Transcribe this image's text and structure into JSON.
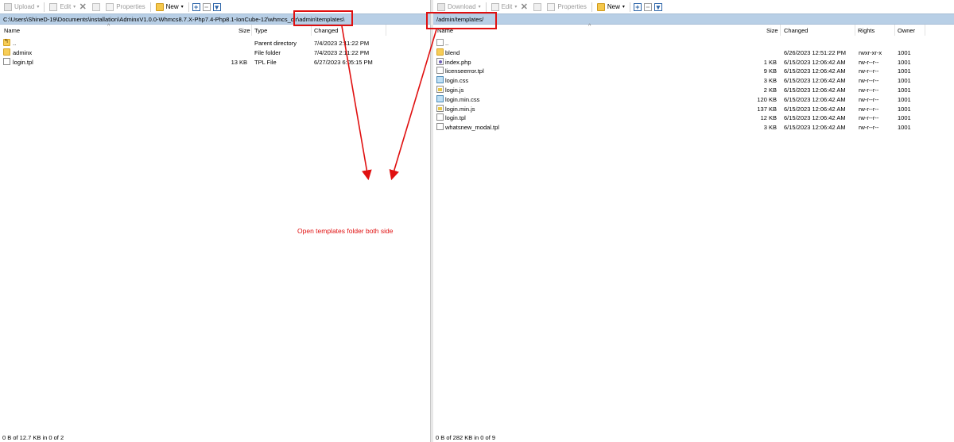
{
  "toolbar_left": {
    "upload_label": "Upload",
    "edit_label": "Edit",
    "properties_label": "Properties",
    "new_label": "New"
  },
  "toolbar_right": {
    "download_label": "Download",
    "edit_label": "Edit",
    "properties_label": "Properties",
    "new_label": "New"
  },
  "left": {
    "path": "C:\\Users\\ShineD-19\\Documents\\installation\\AdminxV1.0.0-Whmcs8.7.X-Php7.4-Php8.1-IonCube-12\\whmcs_dir\\admin\\templates\\",
    "columns": {
      "name": "Name",
      "size": "Size",
      "type": "Type",
      "changed": "Changed"
    },
    "files": [
      {
        "name": "..",
        "size": "",
        "type": "Parent directory",
        "changed": "7/4/2023  2:11:22 PM",
        "icon": "parent-folder-icon"
      },
      {
        "name": "adminx",
        "size": "",
        "type": "File folder",
        "changed": "7/4/2023  2:11:22 PM",
        "icon": "folder-icon"
      },
      {
        "name": "login.tpl",
        "size": "13 KB",
        "type": "TPL File",
        "changed": "6/27/2023  6:05:15 PM",
        "icon": "file-icon"
      }
    ],
    "status": "0 B of 12.7 KB in 0 of 2"
  },
  "right": {
    "path": "/admin/templates/",
    "columns": {
      "name": "Name",
      "size": "Size",
      "changed": "Changed",
      "rights": "Rights",
      "owner": "Owner"
    },
    "files": [
      {
        "name": "..",
        "size": "",
        "changed": "",
        "rights": "",
        "owner": "",
        "icon": "parent-folder-icon"
      },
      {
        "name": "blend",
        "size": "",
        "changed": "6/26/2023 12:51:22 PM",
        "rights": "rwxr-xr-x",
        "owner": "1001",
        "icon": "folder-icon"
      },
      {
        "name": "index.php",
        "size": "1 KB",
        "changed": "6/15/2023 12:06:42 AM",
        "rights": "rw-r--r--",
        "owner": "1001",
        "icon": "php-file-icon"
      },
      {
        "name": "licenseerror.tpl",
        "size": "9 KB",
        "changed": "6/15/2023 12:06:42 AM",
        "rights": "rw-r--r--",
        "owner": "1001",
        "icon": "file-icon"
      },
      {
        "name": "login.css",
        "size": "3 KB",
        "changed": "6/15/2023 12:06:42 AM",
        "rights": "rw-r--r--",
        "owner": "1001",
        "icon": "css-file-icon"
      },
      {
        "name": "login.js",
        "size": "2 KB",
        "changed": "6/15/2023 12:06:42 AM",
        "rights": "rw-r--r--",
        "owner": "1001",
        "icon": "js-file-icon"
      },
      {
        "name": "login.min.css",
        "size": "120 KB",
        "changed": "6/15/2023 12:06:42 AM",
        "rights": "rw-r--r--",
        "owner": "1001",
        "icon": "css-file-icon"
      },
      {
        "name": "login.min.js",
        "size": "137 KB",
        "changed": "6/15/2023 12:06:42 AM",
        "rights": "rw-r--r--",
        "owner": "1001",
        "icon": "js-file-icon"
      },
      {
        "name": "login.tpl",
        "size": "12 KB",
        "changed": "6/15/2023 12:06:42 AM",
        "rights": "rw-r--r--",
        "owner": "1001",
        "icon": "file-icon"
      },
      {
        "name": "whatsnew_modal.tpl",
        "size": "3 KB",
        "changed": "6/15/2023 12:06:42 AM",
        "rights": "rw-r--r--",
        "owner": "1001",
        "icon": "file-icon"
      }
    ],
    "status": "0 B of 282 KB in 0 of 9"
  },
  "annotation": {
    "text": "Open templates folder both side",
    "color": "#e01010"
  }
}
